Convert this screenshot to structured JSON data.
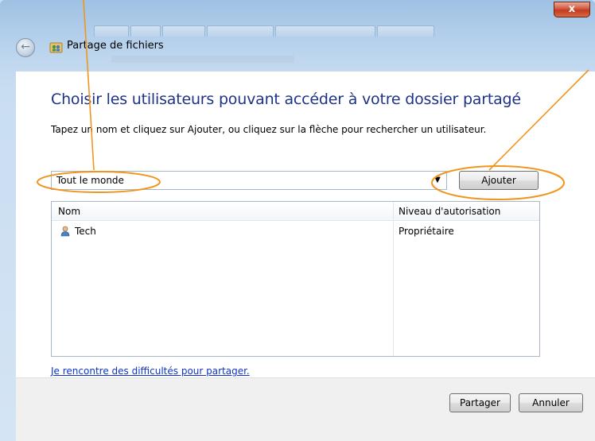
{
  "window": {
    "title": "Partage de fichiers",
    "close_symbol": "x"
  },
  "panel": {
    "heading": "Choisir les utilisateurs pouvant accéder à votre dossier partagé",
    "instruction": "Tapez un nom et cliquez sur Ajouter, ou cliquez sur la flèche pour rechercher un utilisateur.",
    "combo_value": "Tout le monde",
    "add_label": "Ajouter",
    "columns": {
      "name": "Nom",
      "level": "Niveau d'autorisation"
    },
    "rows": [
      {
        "name": "Tech",
        "level": "Propriétaire"
      }
    ],
    "help_link": "Je rencontre des difficultés pour partager."
  },
  "footer": {
    "share_label": "Partager",
    "cancel_label": "Annuler"
  },
  "icons": {
    "back": "back-arrow-icon",
    "title": "file-sharing-icon",
    "user": "user-icon",
    "dropdown": "chevron-down-icon"
  },
  "colors": {
    "heading": "#1e3287",
    "link": "#0f33c8",
    "annotation": "#f0961e",
    "close": "#c23b1f"
  }
}
